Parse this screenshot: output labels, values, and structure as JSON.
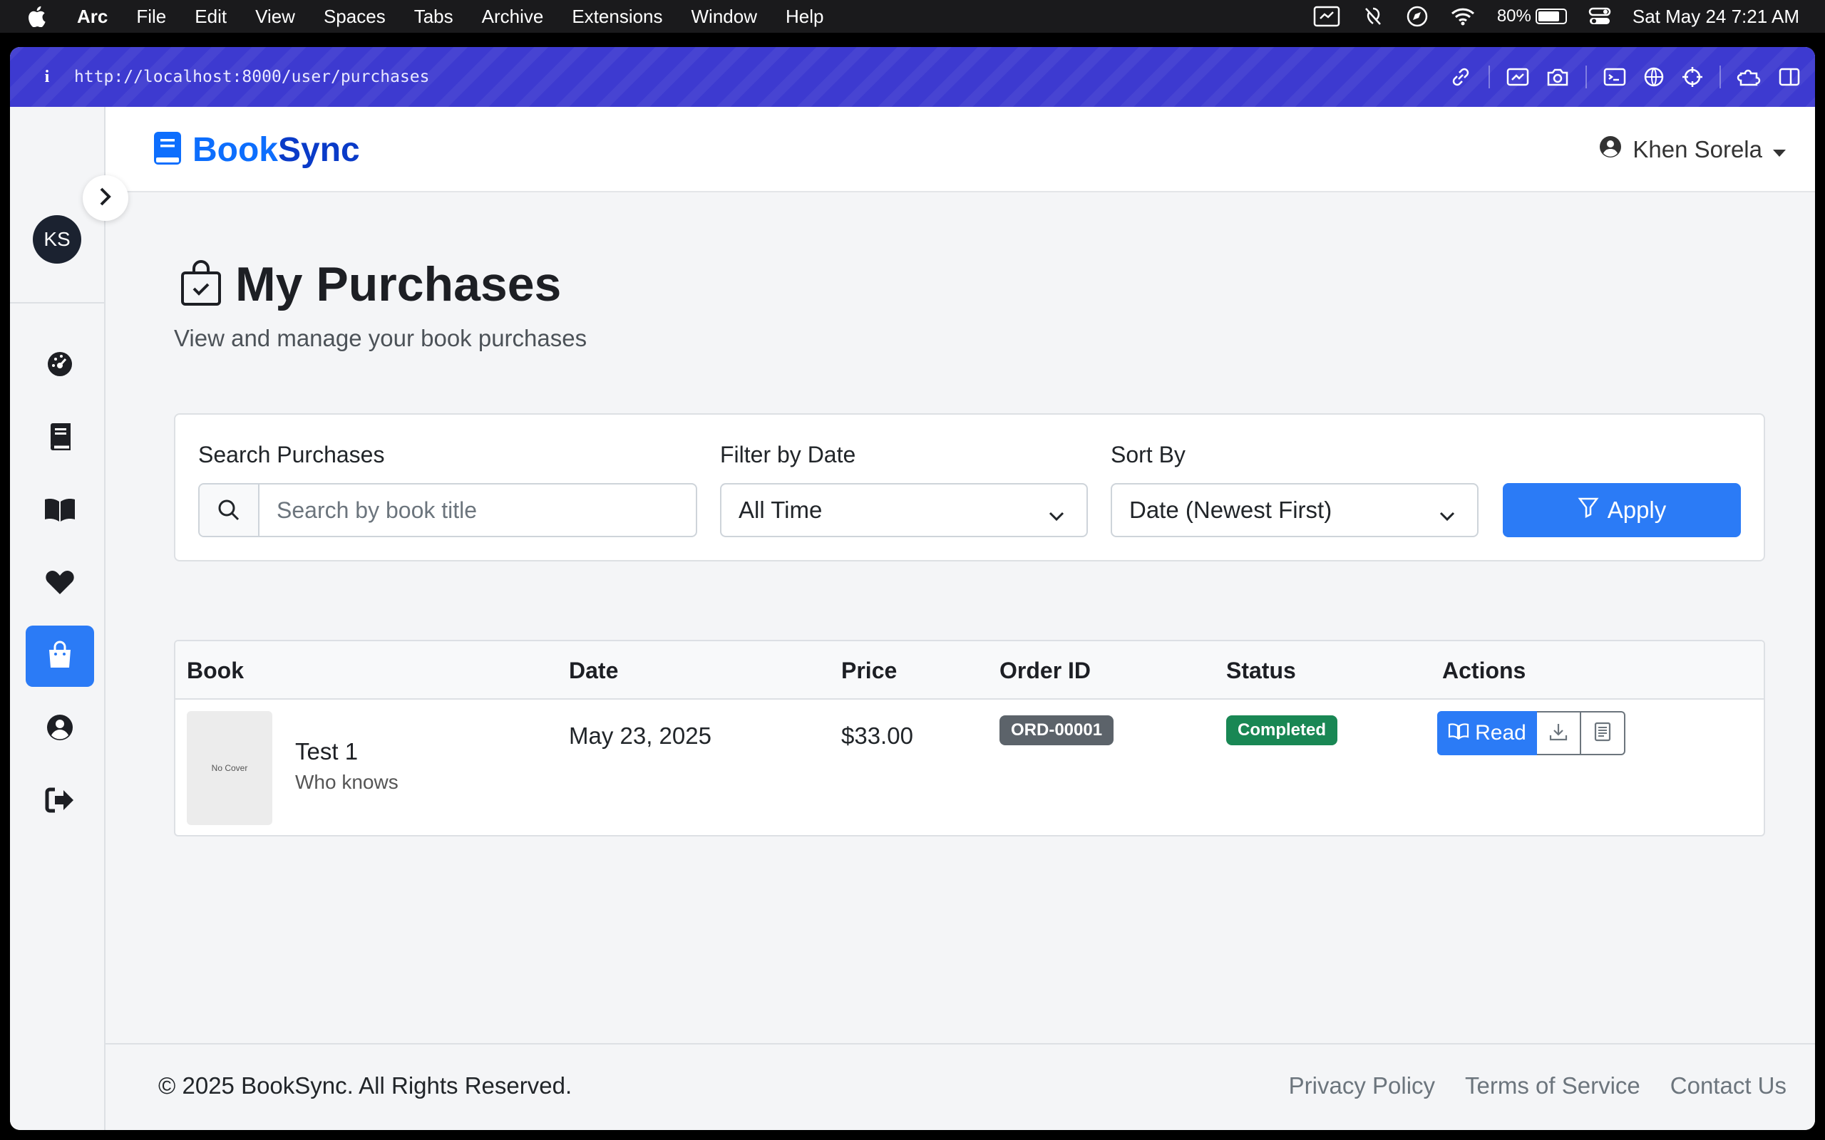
{
  "menubar": {
    "app_name": "Arc",
    "items": [
      "File",
      "Edit",
      "View",
      "Spaces",
      "Tabs",
      "Archive",
      "Extensions",
      "Window",
      "Help"
    ],
    "battery_percent": "80%",
    "battery_level": 0.8,
    "datetime": "Sat May 24  7:21 AM"
  },
  "browser": {
    "info_icon": "i",
    "url": "http://localhost:8000/user/purchases"
  },
  "rail": {
    "avatar_initials": "KS",
    "nav_items": [
      "dashboard",
      "books",
      "library",
      "wishlist",
      "purchases",
      "profile",
      "logout"
    ],
    "active_item": "purchases"
  },
  "navbar": {
    "brand_part1": "Book",
    "brand_part2": "Sync",
    "user_name": "Khen Sorela"
  },
  "page": {
    "title": "My Purchases",
    "subtitle": "View and manage your book purchases"
  },
  "filters": {
    "search_label": "Search Purchases",
    "search_placeholder": "Search by book title",
    "date_label": "Filter by Date",
    "date_value": "All Time",
    "sort_label": "Sort By",
    "sort_value": "Date (Newest First)",
    "apply_label": "Apply"
  },
  "table": {
    "headers": {
      "book": "Book",
      "date": "Date",
      "price": "Price",
      "order_id": "Order ID",
      "status": "Status",
      "actions": "Actions"
    },
    "rows": [
      {
        "cover_text": "No Cover",
        "title": "Test 1",
        "author": "Who knows",
        "date": "May 23, 2025",
        "price": "$33.00",
        "order_id": "ORD-00001",
        "status": "Completed",
        "read_label": "Read"
      }
    ]
  },
  "footer": {
    "copyright": "© 2025 BookSync. All Rights Reserved.",
    "links": [
      "Privacy Policy",
      "Terms of Service",
      "Contact Us"
    ]
  },
  "colors": {
    "primary": "#2b7bf6",
    "brand_dark": "#0a3bc8",
    "status_completed": "#198754",
    "order_badge": "#6c757d",
    "urlbar": "#3d3ad0"
  }
}
